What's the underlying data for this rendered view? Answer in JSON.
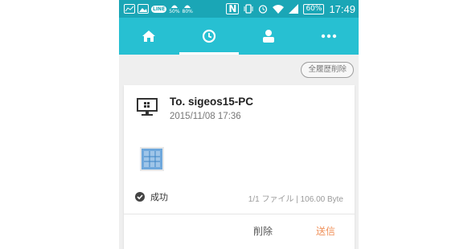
{
  "status_bar": {
    "rain1": "50%",
    "rain2": "80%",
    "line_label": "LINE",
    "nfc_label": "N",
    "battery": "60%",
    "time": "17:49"
  },
  "tabs": [
    {
      "name": "home",
      "icon": "home-icon"
    },
    {
      "name": "history",
      "icon": "clock-icon",
      "active": true
    },
    {
      "name": "profile",
      "icon": "person-icon"
    },
    {
      "name": "more",
      "icon": "more-icon"
    }
  ],
  "history": {
    "clear_all_label": "全履歴削除",
    "item": {
      "title": "To. sigeos15-PC",
      "date": "2015/11/08 17:36",
      "status": "成功",
      "file_info": "1/1 ファイル | 106.00 Byte",
      "delete_label": "削除",
      "send_label": "送信"
    }
  },
  "colors": {
    "status_bar": "#1aa6b6",
    "tab_bar": "#27c0d2",
    "accent_send": "#f0915a"
  }
}
